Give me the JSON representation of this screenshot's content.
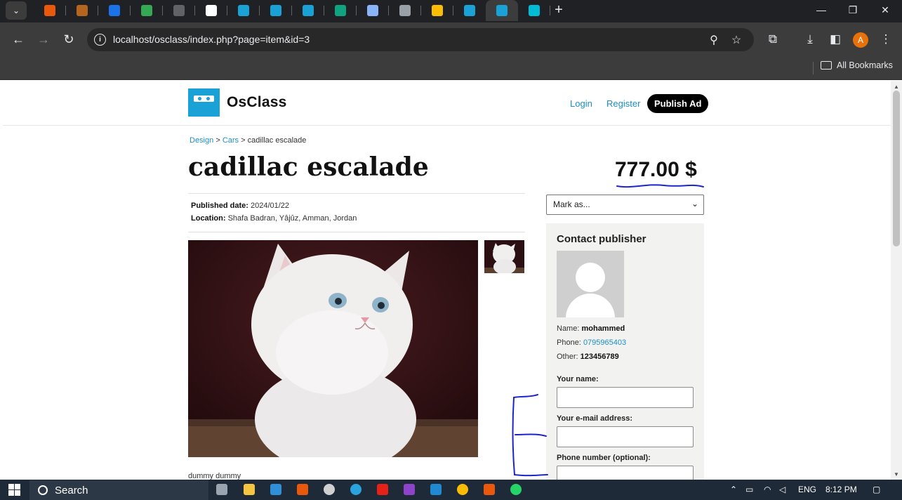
{
  "browser": {
    "url": "localhost/osclass/index.php?page=item&id=3",
    "bookmarks_label": "All Bookmarks",
    "profile_initial": "A",
    "tab_favicon_colors": [
      "#e8590c",
      "#b5651d",
      "#1a73e8",
      "#34a853",
      "#5f6368",
      "#ffffff",
      "#1aa2d6",
      "#1aa2d6",
      "#1aa2d6",
      "#10a37f",
      "#8ab4f8",
      "#9aa0a6",
      "#fbbc04",
      "#1aa2d6",
      "#1aa2d6",
      "#00bcd4"
    ]
  },
  "site": {
    "brand": "OsClass",
    "nav": {
      "login": "Login",
      "register": "Register",
      "publish": "Publish Ad"
    }
  },
  "item": {
    "breadcrumb": {
      "level1": "Design",
      "level2": "Cars",
      "current": "cadillac escalade",
      "separator": ">"
    },
    "title": "cadillac escalade",
    "price": "777.00 $",
    "published_label": "Published date:",
    "published_value": "2024/01/22",
    "location_label": "Location:",
    "location_value": "Shafa Badran, Yâjûz, Amman, Jordan",
    "mark_as": "Mark as...",
    "description": "dummy dummy"
  },
  "contact": {
    "heading": "Contact publisher",
    "name_label": "Name:",
    "name_value": "mohammed",
    "phone_label": "Phone:",
    "phone_value": "0795965403",
    "other_label": "Other:",
    "other_value": "123456789",
    "your_name_label": "Your name:",
    "email_label": "Your e-mail address:",
    "phone_optional_label": "Phone number (optional):"
  },
  "taskbar": {
    "search_label": "Search",
    "language": "ENG",
    "time": "8:12 PM"
  },
  "colors": {
    "accent": "#1a8fc4",
    "logo": "#1aa2d6",
    "annotation_ink": "#1d24c9"
  }
}
